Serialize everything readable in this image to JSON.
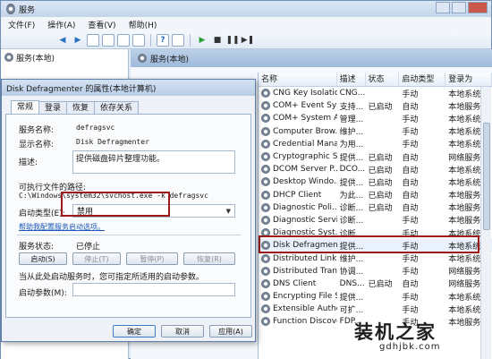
{
  "services_window": {
    "title": "服务",
    "menu": [
      "文件(F)",
      "操作(A)",
      "查看(V)",
      "帮助(H)"
    ],
    "tree_item": "服务(本地)",
    "right_header": "服务(本地)"
  },
  "list": {
    "columns": [
      "名称",
      "描述",
      "状态",
      "启动类型",
      "登录为"
    ],
    "rows": [
      {
        "name": "CNG Key Isolation",
        "desc": "CNG...",
        "status": "",
        "type": "手动",
        "login": "本地系统"
      },
      {
        "name": "COM+ Event Sys...",
        "desc": "支持...",
        "status": "已启动",
        "type": "自动",
        "login": "本地服务"
      },
      {
        "name": "COM+ System A...",
        "desc": "管理...",
        "status": "",
        "type": "手动",
        "login": "本地系统"
      },
      {
        "name": "Computer Brow...",
        "desc": "维护...",
        "status": "",
        "type": "手动",
        "login": "本地系统"
      },
      {
        "name": "Credential Mana...",
        "desc": "为用...",
        "status": "",
        "type": "手动",
        "login": "本地系统"
      },
      {
        "name": "Cryptographic S...",
        "desc": "提供...",
        "status": "已启动",
        "type": "自动",
        "login": "网络服务"
      },
      {
        "name": "DCOM Server P...",
        "desc": "DCO...",
        "status": "已启动",
        "type": "自动",
        "login": "本地系统"
      },
      {
        "name": "Desktop Windo...",
        "desc": "提供...",
        "status": "已启动",
        "type": "自动",
        "login": "本地系统"
      },
      {
        "name": "DHCP Client",
        "desc": "为此...",
        "status": "已启动",
        "type": "自动",
        "login": "本地服务"
      },
      {
        "name": "Diagnostic Poli...",
        "desc": "诊断...",
        "status": "已启动",
        "type": "自动",
        "login": "本地服务"
      },
      {
        "name": "Diagnostic Servi...",
        "desc": "诊断...",
        "status": "",
        "type": "手动",
        "login": "本地服务"
      },
      {
        "name": "Diagnostic Syst...",
        "desc": "诊断...",
        "status": "",
        "type": "手动",
        "login": "本地系统"
      },
      {
        "name": "Disk Defragmen...",
        "desc": "提供...",
        "status": "",
        "type": "手动",
        "login": "本地系统"
      },
      {
        "name": "Distributed Link ...",
        "desc": "维护...",
        "status": "",
        "type": "手动",
        "login": "本地系统"
      },
      {
        "name": "Distributed Tran...",
        "desc": "协调...",
        "status": "",
        "type": "手动",
        "login": "网络服务"
      },
      {
        "name": "DNS Client",
        "desc": "DNS...",
        "status": "已启动",
        "type": "自动",
        "login": "网络服务"
      },
      {
        "name": "Encrypting File S...",
        "desc": "提供...",
        "status": "",
        "type": "手动",
        "login": "本地系统"
      },
      {
        "name": "Extensible Authe...",
        "desc": "可扩...",
        "status": "",
        "type": "手动",
        "login": "本地系统"
      },
      {
        "name": "Function Discove...",
        "desc": "FDP...",
        "status": "",
        "type": "手动",
        "login": "本地服务"
      }
    ]
  },
  "dialog": {
    "title": "Disk Defragmenter 的属性(本地计算机)",
    "tabs": [
      "常规",
      "登录",
      "恢复",
      "依存关系"
    ],
    "service_name_label": "服务名称:",
    "service_name": "defragsvc",
    "display_name_label": "显示名称:",
    "display_name": "Disk Defragmenter",
    "description_label": "描述:",
    "description": "提供磁盘碎片整理功能。",
    "exe_path_label": "可执行文件的路径:",
    "exe_path": "C:\\Windows\\system32\\svchost.exe -k defragsvc",
    "startup_type_label": "启动类型(E):",
    "startup_type": "禁用",
    "help_link": "帮助我配置服务启动选项。",
    "status_label": "服务状态:",
    "status_value": "已停止",
    "btn_start": "启动(S)",
    "btn_stop": "停止(T)",
    "btn_pause": "暂停(P)",
    "btn_resume": "恢复(R)",
    "hint": "当从此处启动服务时，您可指定所适用的启动参数。",
    "params_label": "启动参数(M):",
    "btn_ok": "确定",
    "btn_cancel": "取消",
    "btn_apply": "应用(A)"
  },
  "watermark": {
    "text": "装机之家",
    "url": "gdhjbk.com"
  }
}
